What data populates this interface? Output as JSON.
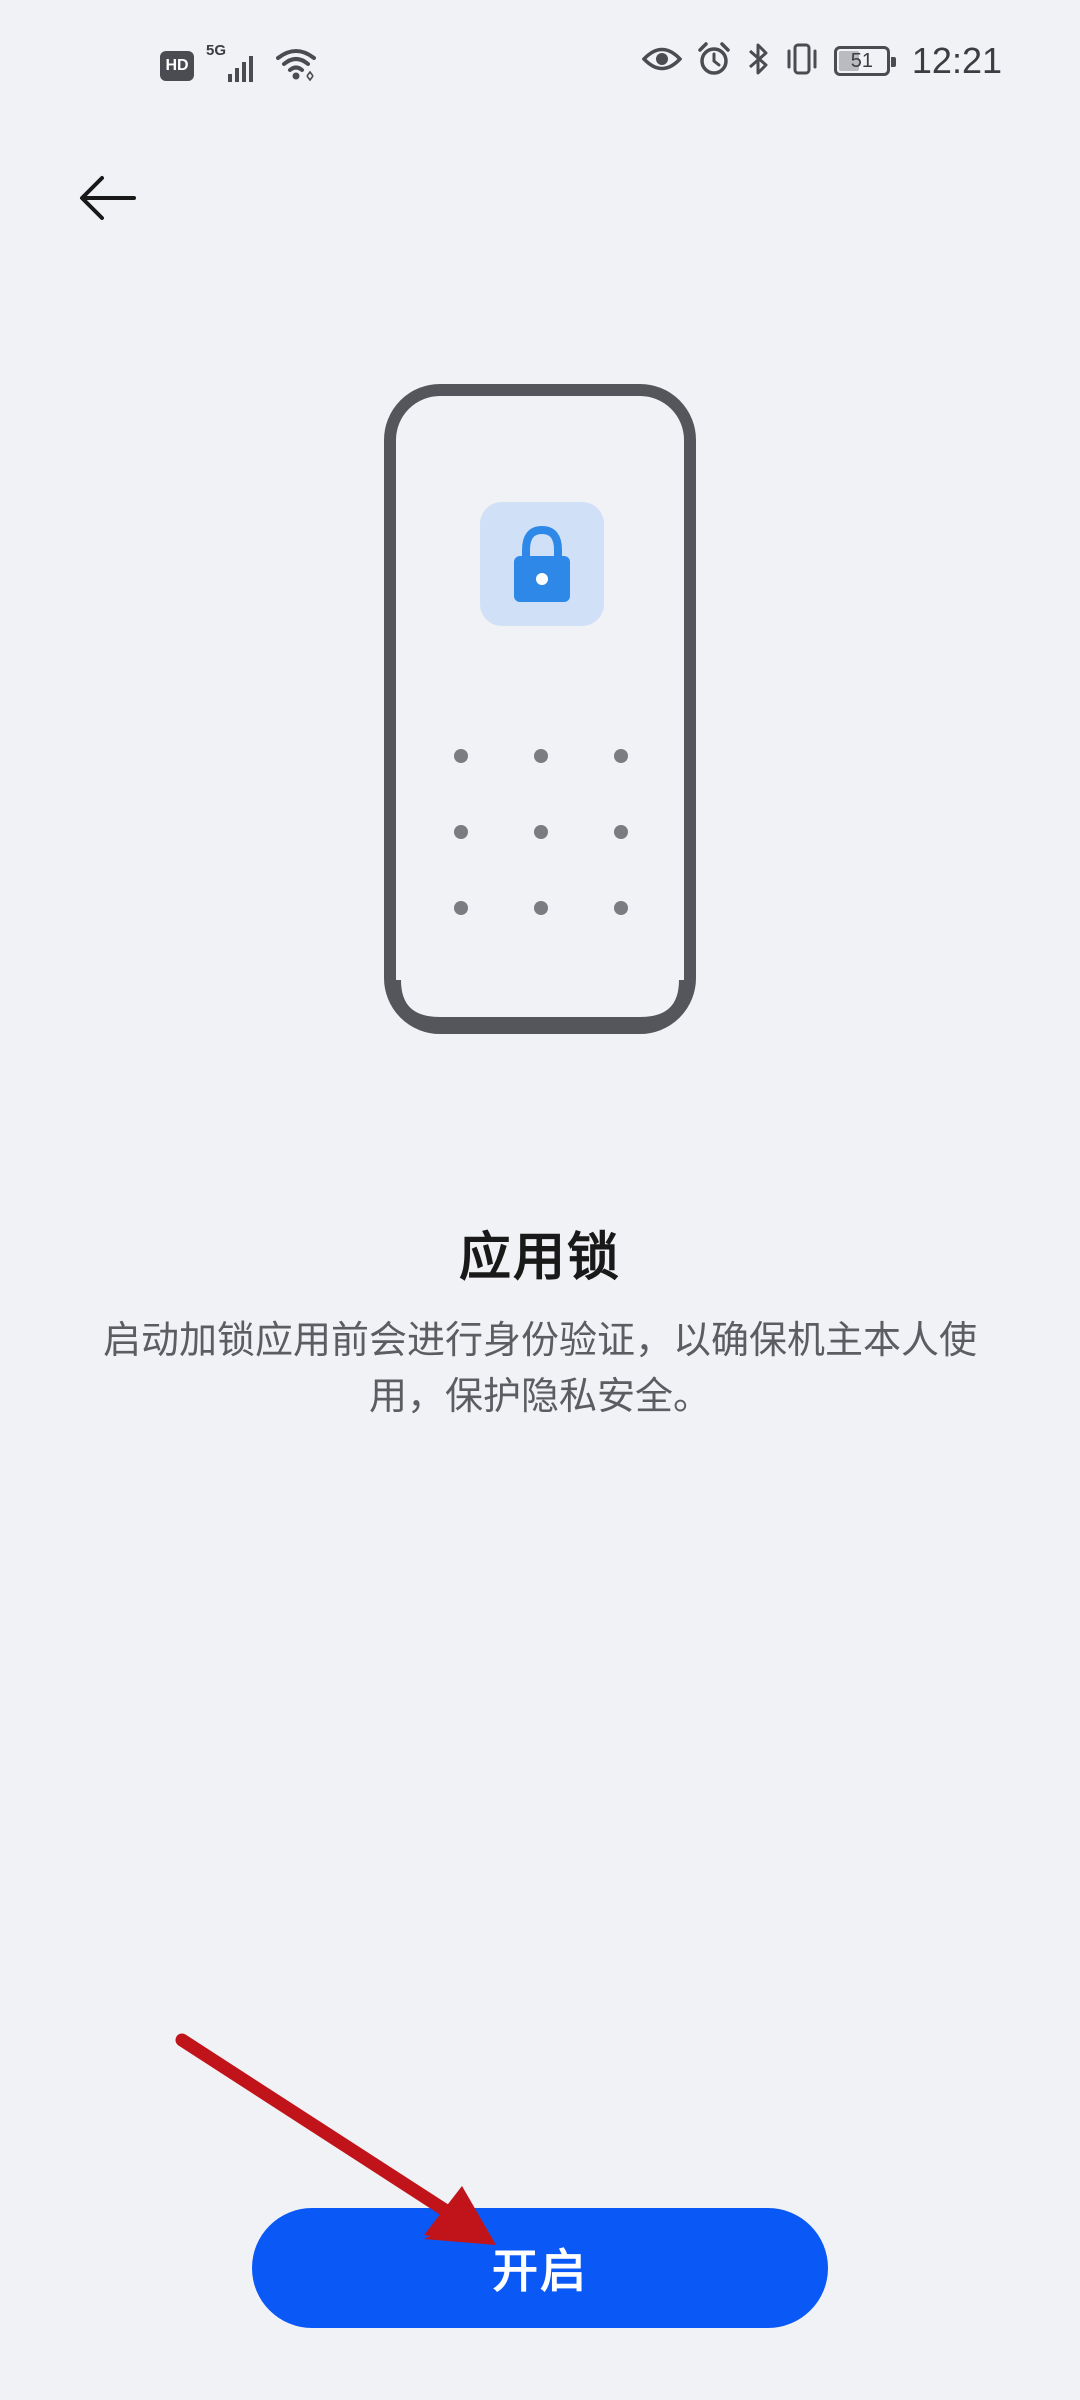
{
  "status_bar": {
    "hd_label": "HD",
    "network_label": "5G",
    "battery_level": "51",
    "time": "12:21",
    "icons": [
      "signal-icon",
      "wifi-icon",
      "eye-comfort-icon",
      "alarm-icon",
      "bluetooth-icon",
      "vibrate-icon",
      "battery-icon"
    ]
  },
  "header": {
    "back_icon": "arrow-left-icon"
  },
  "illustration": {
    "lock_icon": "lock-icon",
    "lock_tile_color": "#cfe0f7",
    "lock_color": "#2e88e8",
    "frame_color": "#54565c",
    "dot_color": "#7a7c82"
  },
  "content": {
    "title": "应用锁",
    "description": "启动加锁应用前会进行身份验证，以确保机主本人使用，保护隐私安全。"
  },
  "actions": {
    "enable_label": "开启",
    "button_color": "#0a59f7"
  },
  "annotation": {
    "arrow_color": "#c0141a"
  }
}
